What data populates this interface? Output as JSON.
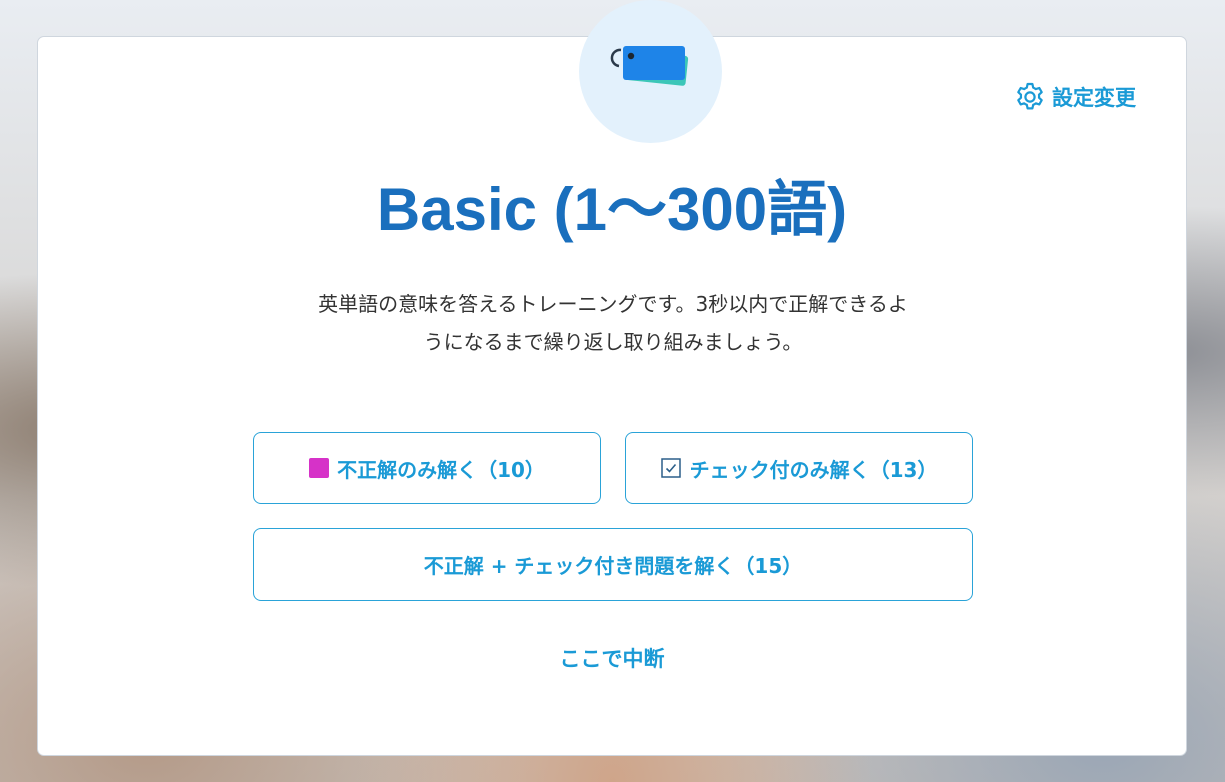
{
  "header": {
    "settings_label": "設定変更",
    "settings_icon": "gear-icon",
    "badge_icon": "flashcards-icon"
  },
  "title": "Basic (1〜300語)",
  "description": {
    "line1": "英単語の意味を答えるトレーニングです。3秒以内で正解できるよ",
    "line2": "うになるまで繰り返し取り組みましょう。"
  },
  "buttons": {
    "wrong_only": "不正解のみ解く（10）",
    "checked_only": "チェック付のみ解く（13）",
    "wrong_and_checked": "不正解 + チェック付き問題を解く（15）",
    "quit": "ここで中断"
  },
  "colors": {
    "accent": "#1a9ad6",
    "title": "#1a6fbd",
    "wrong_marker": "#d632c8",
    "badge_bg": "#e3f1fc"
  }
}
